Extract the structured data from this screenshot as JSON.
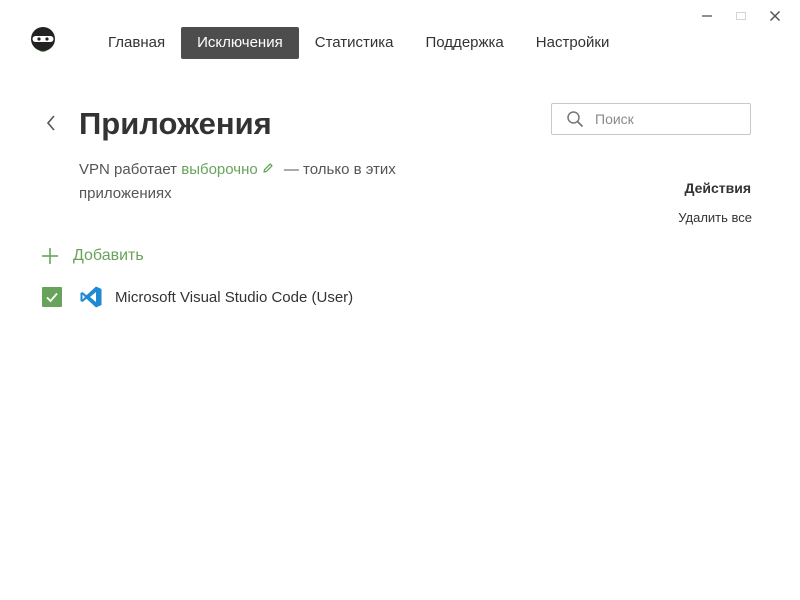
{
  "nav": {
    "items": [
      {
        "label": "Главная",
        "active": false
      },
      {
        "label": "Исключения",
        "active": true
      },
      {
        "label": "Статистика",
        "active": false
      },
      {
        "label": "Поддержка",
        "active": false
      },
      {
        "label": "Настройки",
        "active": false
      }
    ]
  },
  "page": {
    "title": "Приложения"
  },
  "search": {
    "placeholder": "Поиск",
    "value": ""
  },
  "description": {
    "prefix": "VPN работает ",
    "mode": "выборочно",
    "suffix": " — только в этих приложениях"
  },
  "actions": {
    "title": "Действия",
    "delete_all": "Удалить все"
  },
  "add": {
    "label": "Добавить"
  },
  "apps": [
    {
      "name": "Microsoft Visual Studio Code (User)",
      "checked": true,
      "icon": "vscode-icon"
    }
  ],
  "colors": {
    "accent": "#67a35a",
    "nav_active_bg": "#4d4d4d",
    "vscode_blue": "#1f8ad2"
  }
}
